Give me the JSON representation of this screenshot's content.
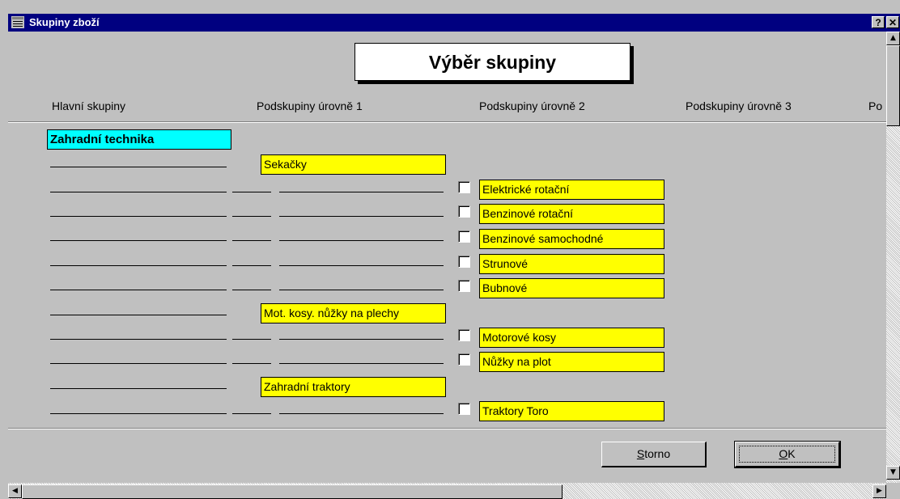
{
  "window": {
    "title": "Skupiny zboží",
    "help_btn": "?",
    "close_btn": "✕"
  },
  "heading": "Výběr skupiny",
  "columns": [
    "Hlavní skupiny",
    "Podskupiny úrovně 1",
    "Podskupiny úrovně 2",
    "Podskupiny úrovně 3",
    "Po"
  ],
  "main_group": "Zahradní technika",
  "level1": [
    {
      "label": "Sekačky"
    },
    {
      "label": "Mot. kosy. nůžky na plechy"
    },
    {
      "label": "Zahradní traktory"
    }
  ],
  "level2": [
    {
      "label": "Elektrické rotační",
      "checked": false
    },
    {
      "label": "Benzinové rotační",
      "checked": false
    },
    {
      "label": "Benzinové samochodné",
      "checked": false
    },
    {
      "label": "Strunové",
      "checked": false
    },
    {
      "label": "Bubnové",
      "checked": false
    },
    {
      "label": "Motorové kosy",
      "checked": false
    },
    {
      "label": "Nůžky na plot",
      "checked": false
    },
    {
      "label": "Traktory Toro",
      "checked": false
    }
  ],
  "buttons": {
    "storno_prefix": "S",
    "storno_rest": "torno",
    "ok_prefix": "O",
    "ok_rest": "K"
  },
  "colors": {
    "title_bar": "#000080",
    "main_group": "#00ffff",
    "subgroup": "#ffff00",
    "window": "#c0c0c0"
  }
}
